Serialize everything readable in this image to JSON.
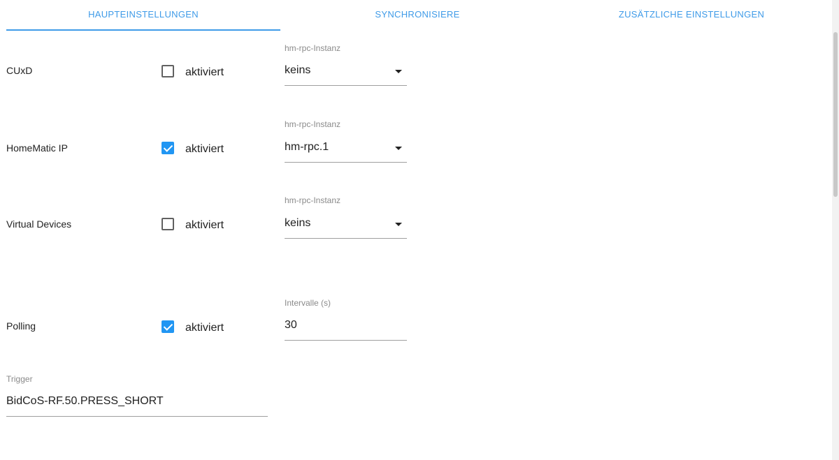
{
  "tabs": [
    {
      "label": "HAUPTEINSTELLUNGEN",
      "active": true
    },
    {
      "label": "SYNCHRONISIERE",
      "active": false
    },
    {
      "label": "ZUSÄTZLICHE EINSTELLUNGEN",
      "active": false
    }
  ],
  "rows": [
    {
      "label": "CUxD",
      "checkbox_label": "aktiviert",
      "checked": false,
      "field_label": "hm-rpc-Instanz",
      "field_value": "keins",
      "field_type": "select"
    },
    {
      "label": "HomeMatic IP",
      "checkbox_label": "aktiviert",
      "checked": true,
      "field_label": "hm-rpc-Instanz",
      "field_value": "hm-rpc.1",
      "field_type": "select"
    },
    {
      "label": "Virtual Devices",
      "checkbox_label": "aktiviert",
      "checked": false,
      "field_label": "hm-rpc-Instanz",
      "field_value": "keins",
      "field_type": "select"
    },
    {
      "label": "Polling",
      "checkbox_label": "aktiviert",
      "checked": true,
      "field_label": "Intervalle (s)",
      "field_value": "30",
      "field_type": "text"
    }
  ],
  "trigger": {
    "label": "Trigger",
    "value": "BidCoS-RF.50.PRESS_SHORT"
  },
  "colors": {
    "accent": "#3f9be8",
    "checkbox_checked": "#2196f3"
  }
}
